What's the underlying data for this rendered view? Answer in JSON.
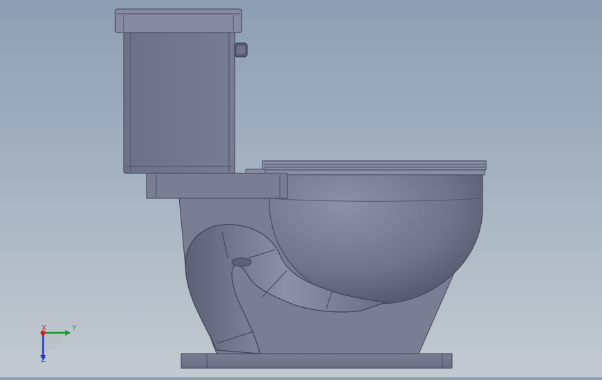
{
  "viewport": {
    "model": "toilet",
    "background_top": "#8e9fb3",
    "background_bottom": "#c3cad1"
  },
  "triad": {
    "x_label": "X",
    "y_label": "Y",
    "z_label": "Z",
    "x_color": "#d21e1e",
    "y_color": "#1e9a2a",
    "z_color": "#1e3ad2"
  }
}
